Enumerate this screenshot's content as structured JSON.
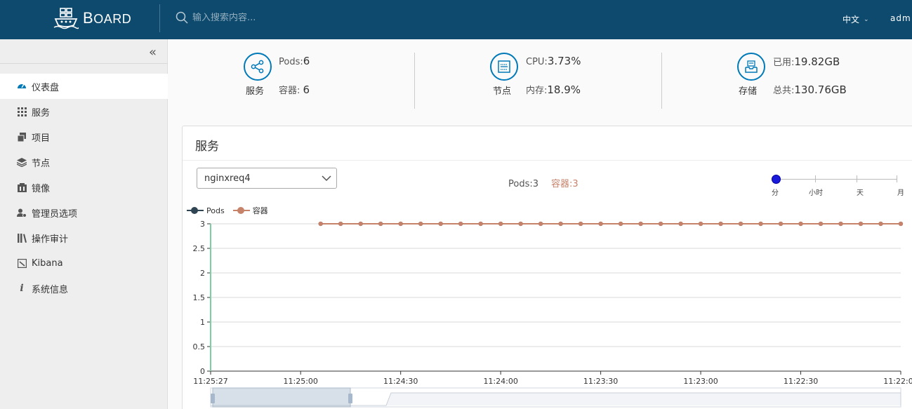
{
  "header": {
    "brand": "BOARD",
    "search_placeholder": "输入搜索内容...",
    "language": "中文",
    "user": "adm"
  },
  "sidebar": {
    "items": [
      {
        "label": "仪表盘",
        "icon": "dashboard-icon",
        "active": true
      },
      {
        "label": "服务",
        "icon": "grid-icon",
        "active": false
      },
      {
        "label": "项目",
        "icon": "project-icon",
        "active": false
      },
      {
        "label": "节点",
        "icon": "layers-icon",
        "active": false
      },
      {
        "label": "镜像",
        "icon": "image-icon",
        "active": false
      },
      {
        "label": "管理员选项",
        "icon": "admin-users-icon",
        "active": false
      },
      {
        "label": "操作审计",
        "icon": "audit-icon",
        "active": false
      },
      {
        "label": "Kibana",
        "icon": "kibana-icon",
        "active": false
      },
      {
        "label": "系统信息",
        "icon": "info-icon",
        "active": false
      }
    ]
  },
  "stats": {
    "service": {
      "caption": "服务",
      "line1_label": "Pods:",
      "line1_value": "6",
      "line2_label": "容器: ",
      "line2_value": "6"
    },
    "node": {
      "caption": "节点",
      "line1_label": "CPU:",
      "line1_value": "3.73%",
      "line2_label": "内存:",
      "line2_value": "18.9%"
    },
    "storage": {
      "caption": "存储",
      "line1_label": "已用:",
      "line1_value": "19.82GB",
      "line2_label": "总共:",
      "line2_value": "130.76GB"
    }
  },
  "card": {
    "title": "服务",
    "selected_service": "nginxreq4",
    "pods_summary": "Pods:3",
    "containers_summary": "容器:3",
    "time_scale": {
      "options": [
        "分",
        "小时",
        "天",
        "月"
      ],
      "selected": "分"
    }
  },
  "colors": {
    "header_bg": "#0d4a6e",
    "accent": "#0079b8",
    "pods_series": "#2f4554",
    "containers_series": "#c7826a",
    "cursor_line": "#7ccfa3"
  },
  "chart_data": {
    "type": "line",
    "x": [
      "11:25:27",
      "11:25:24",
      "11:25:21",
      "11:25:18",
      "11:25:15",
      "11:25:12",
      "11:25:09",
      "11:25:06",
      "11:25:03",
      "11:25:00",
      "11:24:57",
      "11:24:54",
      "11:24:51",
      "11:24:48",
      "11:24:45",
      "11:24:42",
      "11:24:39",
      "11:24:36",
      "11:24:33",
      "11:24:30",
      "11:24:27",
      "11:24:24",
      "11:24:21",
      "11:24:18",
      "11:24:15",
      "11:24:12",
      "11:24:09",
      "11:24:06",
      "11:24:03",
      "11:24:00",
      "11:23:57",
      "11:23:54",
      "11:23:51",
      "11:23:48",
      "11:23:45",
      "11:23:42",
      "11:23:39",
      "11:23:36",
      "11:23:33",
      "11:23:30",
      "11:23:27",
      "11:23:24",
      "11:23:21",
      "11:23:18",
      "11:23:15",
      "11:23:12",
      "11:23:09",
      "11:23:06",
      "11:23:03",
      "11:23:00",
      "11:22:57",
      "11:22:54",
      "11:22:51",
      "11:22:48",
      "11:22:45",
      "11:22:42",
      "11:22:39",
      "11:22:36",
      "11:22:33",
      "11:22:30",
      "11:22:27",
      "11:22:24",
      "11:22:21",
      "11:22:18",
      "11:22:15",
      "11:22:12",
      "11:22:09",
      "11:22:06",
      "11:22:03",
      "11:22:00"
    ],
    "x_tick_labels": [
      "11:25:27",
      "11:25:00",
      "11:24:30",
      "11:24:00",
      "11:23:30",
      "11:23:00",
      "11:22:30",
      "11:22:00"
    ],
    "y_tick_labels": [
      "0",
      "0.5",
      "1",
      "1.5",
      "2",
      "2.5",
      "3"
    ],
    "ylim": [
      0,
      3
    ],
    "series": [
      {
        "name": "Pods",
        "values": [
          null,
          null,
          null,
          null,
          null,
          null,
          null,
          null,
          null,
          null,
          null,
          3,
          3,
          3,
          3,
          3,
          3,
          3,
          3,
          3,
          3,
          3,
          3,
          3,
          3,
          3,
          3,
          3,
          3,
          3,
          3,
          3,
          3,
          3,
          3,
          3,
          3,
          3,
          3,
          3,
          3,
          3,
          3,
          3,
          3,
          3,
          3,
          3,
          3,
          3,
          3,
          3,
          3,
          3,
          3,
          3,
          3,
          3,
          3,
          3,
          3,
          3,
          3,
          3,
          3,
          3,
          3,
          3,
          3,
          3
        ]
      },
      {
        "name": "容器",
        "values": [
          null,
          null,
          null,
          null,
          null,
          null,
          null,
          null,
          null,
          null,
          null,
          3,
          3,
          3,
          3,
          3,
          3,
          3,
          3,
          3,
          3,
          3,
          3,
          3,
          3,
          3,
          3,
          3,
          3,
          3,
          3,
          3,
          3,
          3,
          3,
          3,
          3,
          3,
          3,
          3,
          3,
          3,
          3,
          3,
          3,
          3,
          3,
          3,
          3,
          3,
          3,
          3,
          3,
          3,
          3,
          3,
          3,
          3,
          3,
          3,
          3,
          3,
          3,
          3,
          3,
          3,
          3,
          3,
          3,
          3
        ]
      }
    ],
    "grid": true,
    "legend": "top-left",
    "cursor_x": "11:25:27"
  }
}
